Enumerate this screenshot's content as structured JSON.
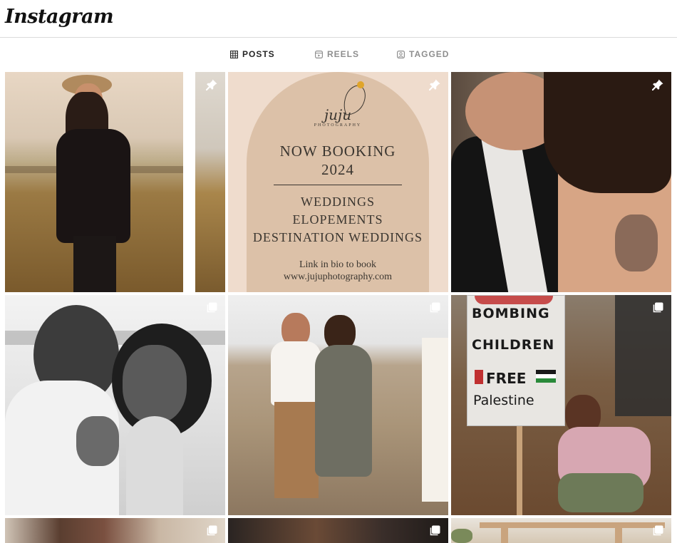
{
  "header": {
    "logo": "Instagram"
  },
  "tabs": [
    {
      "label": "POSTS",
      "icon": "grid-icon",
      "active": true
    },
    {
      "label": "REELS",
      "icon": "reels-icon",
      "active": false
    },
    {
      "label": "TAGGED",
      "icon": "tagged-icon",
      "active": false
    }
  ],
  "posts": [
    {
      "kind": "photo",
      "subject": "woman in hat with cameras in tall grass",
      "pinned": true
    },
    {
      "kind": "promo",
      "pinned": true,
      "brand": "juju",
      "brand_sub": "PHOTOGRAPHY",
      "headline_1": "NOW BOOKING",
      "headline_2": "2024",
      "service_1": "WEDDINGS",
      "service_2": "ELOPEMENTS",
      "service_3": "DESTINATION WEDDINGS",
      "cta": "Link in bio to book",
      "url": "www.jujuphotography.com"
    },
    {
      "kind": "photo",
      "subject": "couple kissing, hair blowing",
      "pinned": true
    },
    {
      "kind": "photo",
      "subject": "black and white couple touching foreheads",
      "carousel": true
    },
    {
      "kind": "photo",
      "subject": "couple laughing on beach",
      "carousel": true
    },
    {
      "kind": "photo",
      "subject": "child holding protest sign",
      "carousel": true,
      "sign_line_1": "BOMBING",
      "sign_line_2": "CHILDREN",
      "sign_line_3": "FREE",
      "sign_line_4": "Palestine"
    },
    {
      "kind": "photo",
      "subject": "couple embrace",
      "carousel": true
    },
    {
      "kind": "photo",
      "subject": "dark warm interior",
      "carousel": true
    },
    {
      "kind": "photo",
      "subject": "wooden pergola",
      "carousel": true
    }
  ],
  "colors": {
    "accent_text": "#262626",
    "muted_text": "#8e8e8e",
    "divider": "#dbdbdb",
    "promo_bg": "#efdccd",
    "promo_arch": "#dcc1a8"
  }
}
